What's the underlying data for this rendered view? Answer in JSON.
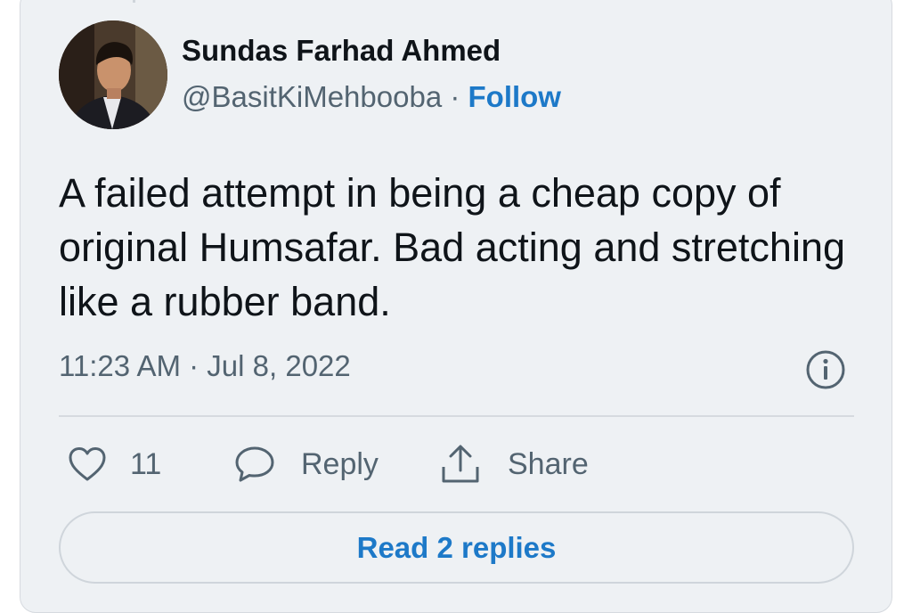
{
  "tweet": {
    "author_name": "Sundas Farhad Ahmed",
    "handle": "@BasitKiMehbooba",
    "separator": " · ",
    "follow_label": "Follow",
    "text": "A failed attempt in being a cheap copy of original Humsafar. Bad acting and stretching like a rubber band.",
    "timestamp": "11:23 AM · Jul 8, 2022"
  },
  "actions": {
    "like_count": "11",
    "reply_label": "Reply",
    "share_label": "Share"
  },
  "footer": {
    "read_replies_label": "Read 2 replies"
  },
  "icons": {
    "avatar": "profile-photo",
    "info": "info-icon",
    "like": "heart-icon",
    "reply": "speech-bubble-icon",
    "share": "share-icon"
  },
  "colors": {
    "accent": "#1d79c8",
    "text_primary": "#0f1419",
    "text_secondary": "#536471",
    "card_background": "#eef1f4"
  }
}
